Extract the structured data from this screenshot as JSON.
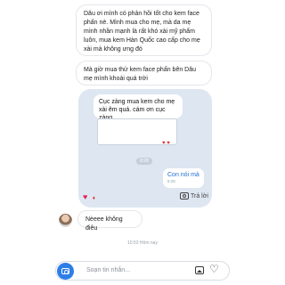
{
  "messages": [
    {
      "text": "Dâu ơi mình có phản hồi tốt cho kem face phấn nè. Mình mua cho mẹ, mà da mẹ mình nhần mạnh là rất khó xài mỹ phẩm luôn, mua kem Hàn Quốc cao cấp cho mẹ xài mà không ưng đó"
    },
    {
      "text": "Mà giờ mua thử kem face phấn bên Dâu mẹ mình khoái quá trời"
    }
  ],
  "shared": {
    "inner_message": "Cục zàng mua kem cho mẹ xài êm quá. cám ơn cục zàng",
    "inner_reactions": "♥ ♥",
    "time": "8:28",
    "reply_text": "Con nói mà",
    "reply_time": "8:28"
  },
  "reactions": {
    "heart": "♥",
    "small": "♦"
  },
  "reply_button": {
    "label": "Trả lời"
  },
  "incoming": {
    "text": "Nèeee không điêu"
  },
  "timestamp": "10:53 Hôm nay",
  "composer": {
    "placeholder": "Soạn tin nhắn..."
  },
  "colors": {
    "accent": "#2e7ee8",
    "shared_bg": "#dde6f1",
    "heart": "#e0245e"
  },
  "icons": [
    "camera-icon",
    "image-icon",
    "heart-icon"
  ]
}
